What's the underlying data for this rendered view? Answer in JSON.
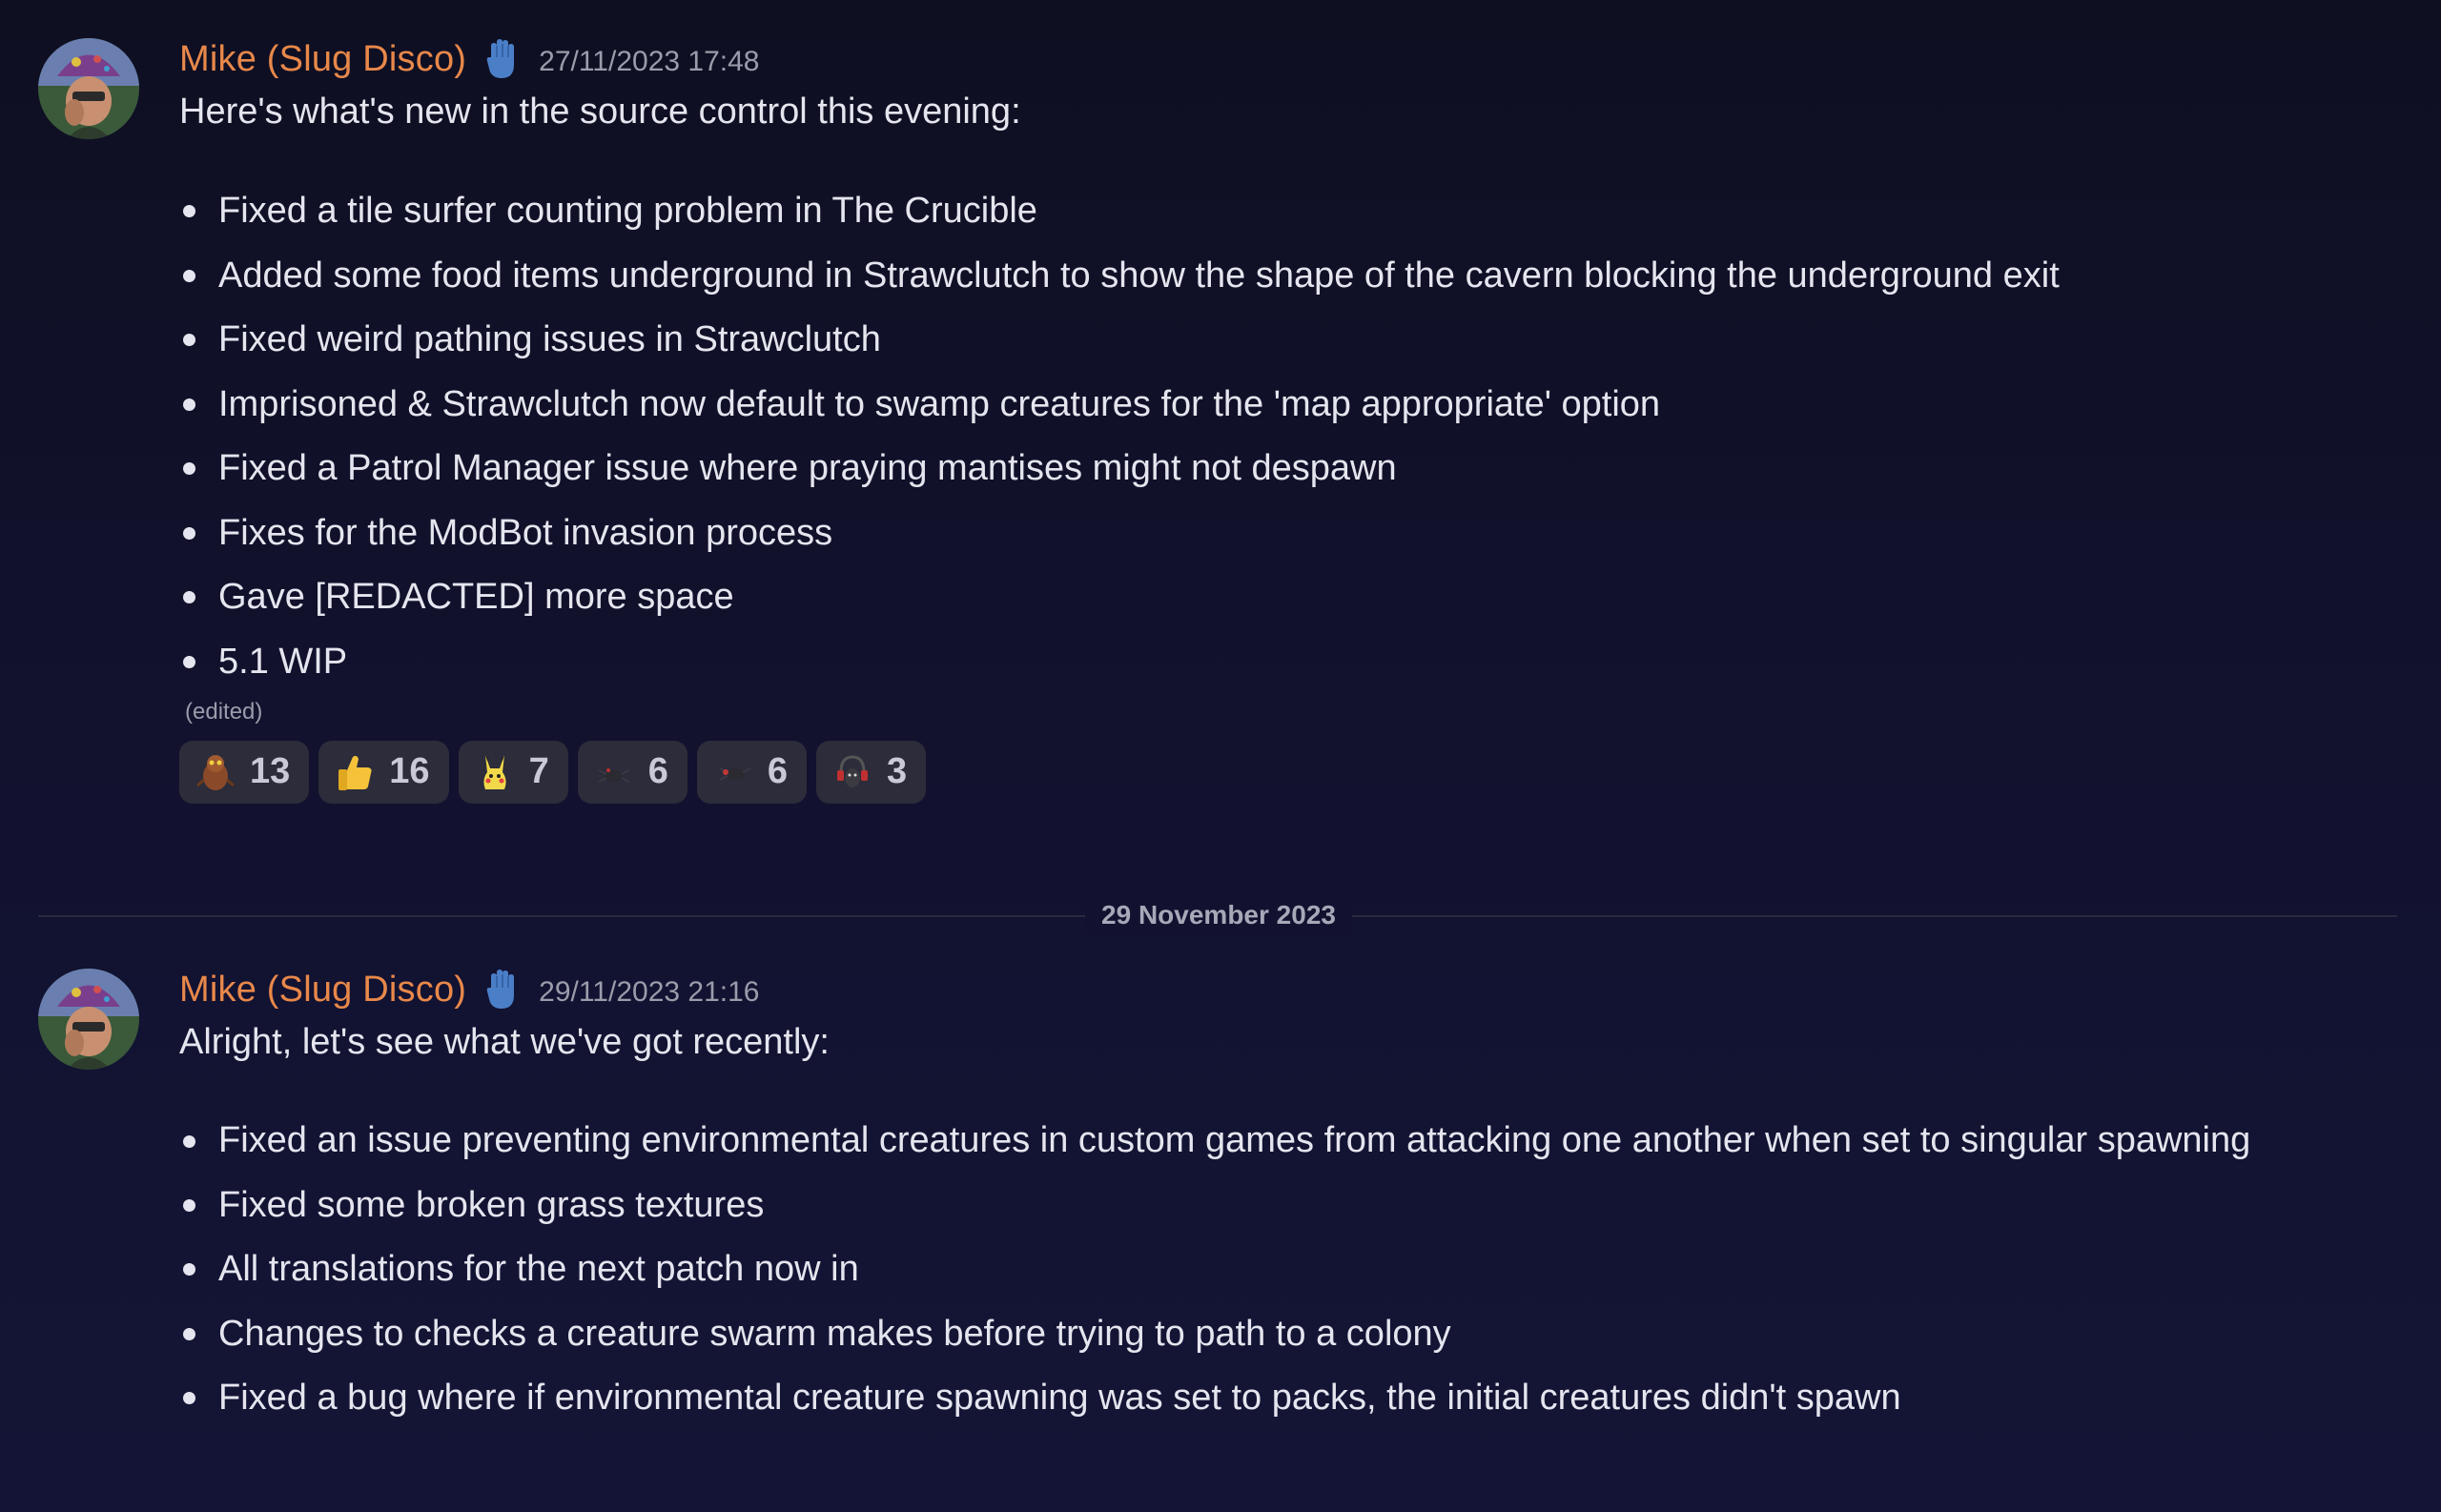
{
  "messages": [
    {
      "author": "Mike (Slug Disco)",
      "timestamp": "27/11/2023 17:48",
      "intro": "Here's what's new in the source control this evening:",
      "items": [
        "Fixed a tile surfer counting problem in The Crucible",
        "Added some food items underground in Strawclutch to show the shape of the cavern blocking the underground exit",
        "Fixed weird pathing issues in Strawclutch",
        "Imprisoned & Strawclutch now default to swamp creatures for the 'map appropriate' option",
        "Fixed a Patrol Manager issue where praying mantises might not despawn",
        "Fixes for the ModBot invasion process",
        "Gave [REDACTED] more space",
        "5.1 WIP"
      ],
      "edited_label": "(edited)",
      "reactions": [
        {
          "icon": "creature-emoji",
          "count": "13"
        },
        {
          "icon": "thumbs-up-emoji",
          "count": "16"
        },
        {
          "icon": "pikachu-emoji",
          "count": "7"
        },
        {
          "icon": "dark-bug-emoji",
          "count": "6"
        },
        {
          "icon": "dark-bug-red-emoji",
          "count": "6"
        },
        {
          "icon": "headphones-bug-emoji",
          "count": "3"
        }
      ]
    },
    {
      "author": "Mike (Slug Disco)",
      "timestamp": "29/11/2023 21:16",
      "intro": "Alright, let's see what we've got recently:",
      "items": [
        "Fixed an issue preventing environmental creatures in custom games from attacking one another when set to singular spawning",
        "Fixed some broken grass textures",
        "All translations for the next patch now in",
        "Changes to checks a creature swarm makes before trying to path to a colony",
        "Fixed a bug where if environmental creature spawning was set to packs, the initial creatures didn't spawn"
      ]
    }
  ],
  "date_divider": "29 November 2023",
  "colors": {
    "background": "#121230",
    "username": "#e8884a",
    "text": "#e4e5ee",
    "muted": "#9b9cab",
    "reaction_bg": "#2c2c3a"
  }
}
